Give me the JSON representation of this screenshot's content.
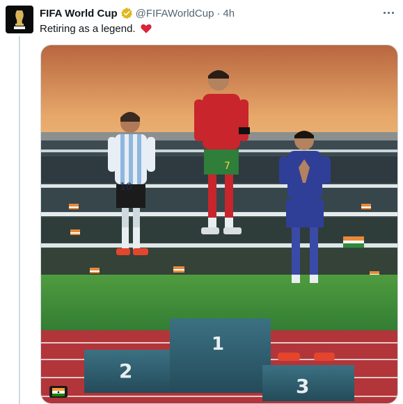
{
  "tweet": {
    "display_name": "FIFA World Cup",
    "handle": "@FIFAWorldCup",
    "separator": "·",
    "time": "4h",
    "text": "Retiring as a legend.",
    "icons": {
      "avatar": "fifa-world-cup-trophy-logo",
      "verified": "gold-verified-badge-icon",
      "emoji": "red-heart-icon",
      "more": "more-options-icon"
    }
  },
  "media": {
    "description_icons": [
      "india-flag-icon"
    ],
    "podium_numbers": {
      "first": "1",
      "second": "2",
      "third": "3"
    },
    "jersey_numbers": {
      "left": "10",
      "center": "7"
    },
    "colors": {
      "sky_top": "#c9744a",
      "sky_mid": "#e9a766",
      "pitch": "#3b8d3a",
      "track": "#b2353a",
      "podium": "#2d5f6f",
      "verified_gold": "#e2b719",
      "heart": "#d9243a"
    }
  }
}
